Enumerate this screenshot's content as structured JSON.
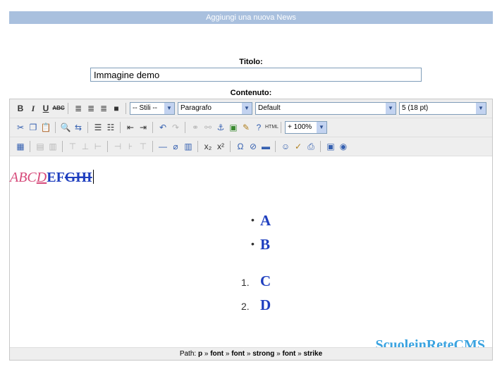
{
  "window": {
    "title": "Aggiungi una nuova News"
  },
  "form": {
    "title_label": "Titolo:",
    "title_value": "Immagine demo",
    "content_label": "Contenuto:"
  },
  "toolbar": {
    "row1": {
      "bold": "B",
      "italic": "I",
      "underline": "U",
      "strike": "ABC",
      "style_select": "-- Stili --",
      "format_select": "Paragrafo",
      "font_select": "Default",
      "size_select": "5 (18 pt)"
    },
    "row2": {
      "zoom_select": "+ 100%"
    }
  },
  "content": {
    "line_italic": "ABC",
    "line_underline": "D",
    "line_bold": "EF",
    "line_strike": "GHI",
    "bullets": [
      "A",
      "B"
    ],
    "numbered": [
      {
        "n": "1.",
        "text": "C"
      },
      {
        "n": "2.",
        "text": "D"
      }
    ],
    "brand": "ScuoleinReteCMS"
  },
  "status": {
    "prefix": "Path:",
    "path": [
      "p",
      "font",
      "font",
      "strong",
      "font",
      "strike"
    ]
  }
}
